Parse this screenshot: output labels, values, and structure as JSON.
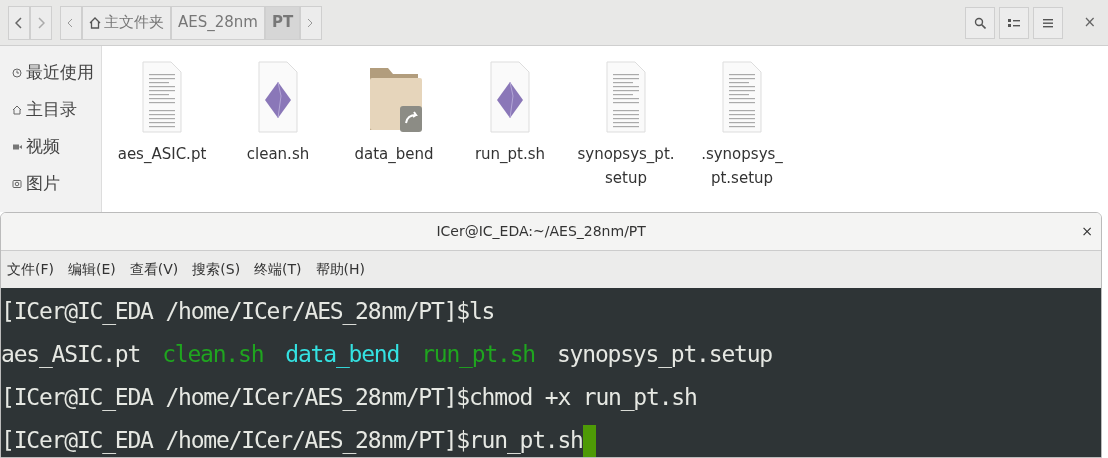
{
  "file_manager": {
    "path_bar": [
      {
        "label": "主文件夹",
        "kind": "home",
        "selected": false
      },
      {
        "label": "AES_28nm",
        "kind": "folder",
        "selected": false
      },
      {
        "label": "PT",
        "kind": "folder",
        "selected": true
      }
    ],
    "sidebar": {
      "items": [
        {
          "label": "最近使用",
          "kind": "recent"
        },
        {
          "label": "主目录",
          "kind": "home"
        },
        {
          "label": "视频",
          "kind": "video"
        },
        {
          "label": "图片",
          "kind": "picture"
        }
      ]
    },
    "files": [
      {
        "name": "aes_ASIC.pt",
        "kind": "text"
      },
      {
        "name": "clean.sh",
        "kind": "script"
      },
      {
        "name": "data_bend",
        "kind": "folder-link"
      },
      {
        "name": "run_pt.sh",
        "kind": "script"
      },
      {
        "name": "synopsys_pt.\nsetup",
        "kind": "text"
      },
      {
        "name": ".synopsys_\npt.setup",
        "kind": "text"
      }
    ],
    "close": "×"
  },
  "terminal": {
    "window": {
      "title": "ICer@IC_EDA:~/AES_28nm/PT",
      "close": "×"
    },
    "menu": [
      "文件(F)",
      "编辑(E)",
      "查看(V)",
      "搜索(S)",
      "终端(T)",
      "帮助(H)"
    ],
    "lines": [
      {
        "cursor": false,
        "segments": [
          {
            "text": "[ICer@IC_EDA /home/ICer/AES_28nm/PT]$ls",
            "kind": "plain"
          }
        ]
      },
      {
        "cursor": false,
        "segments": [
          {
            "text": "aes_ASIC.pt",
            "kind": "plain"
          },
          {
            "text": "clean.sh",
            "kind": "exec"
          },
          {
            "text": "data_bend",
            "kind": "dir"
          },
          {
            "text": "run_pt.sh",
            "kind": "exec"
          },
          {
            "text": "synopsys_pt.setup",
            "kind": "plain"
          }
        ]
      },
      {
        "cursor": false,
        "segments": [
          {
            "text": "[ICer@IC_EDA /home/ICer/AES_28nm/PT]$chmod +x run_pt.sh",
            "kind": "plain"
          }
        ]
      },
      {
        "cursor": true,
        "segments": [
          {
            "text": "[ICer@IC_EDA /home/ICer/AES_28nm/PT]$run_pt.sh",
            "kind": "plain"
          }
        ]
      }
    ]
  }
}
